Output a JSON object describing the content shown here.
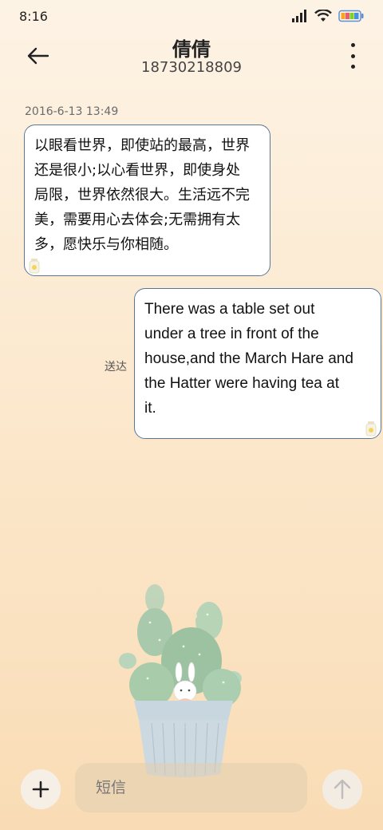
{
  "status_bar": {
    "time": "8:16",
    "icons": [
      "signal-icon",
      "wifi-icon",
      "battery-icon"
    ],
    "battery_colors": [
      "#f5a623",
      "#e85d75",
      "#7ed321",
      "#4a90e2"
    ]
  },
  "header": {
    "contact_name": "倩倩",
    "contact_number": "18730218809"
  },
  "conversation": {
    "timestamp": "2016-6-13 13:49",
    "incoming": {
      "lines": [
        "以眼看世界，即使站的最高，世界",
        "还是很小;以心看世界，即使身处",
        "局限，世界依然很大。生活远不完",
        "美，需要用心去体会;无需拥有太",
        "多，愿快乐与你相随。"
      ]
    },
    "outgoing": {
      "lines": [
        "There was a table set out",
        "under a tree in front of the",
        "house,and the March Hare and",
        "the Hatter were having tea at",
        "it."
      ],
      "status": "送达"
    }
  },
  "input": {
    "placeholder": "短信"
  },
  "colors": {
    "bubble_border": "#5a7796",
    "background_top": "#fdf3e5",
    "background_bottom": "#f9dcb5"
  }
}
